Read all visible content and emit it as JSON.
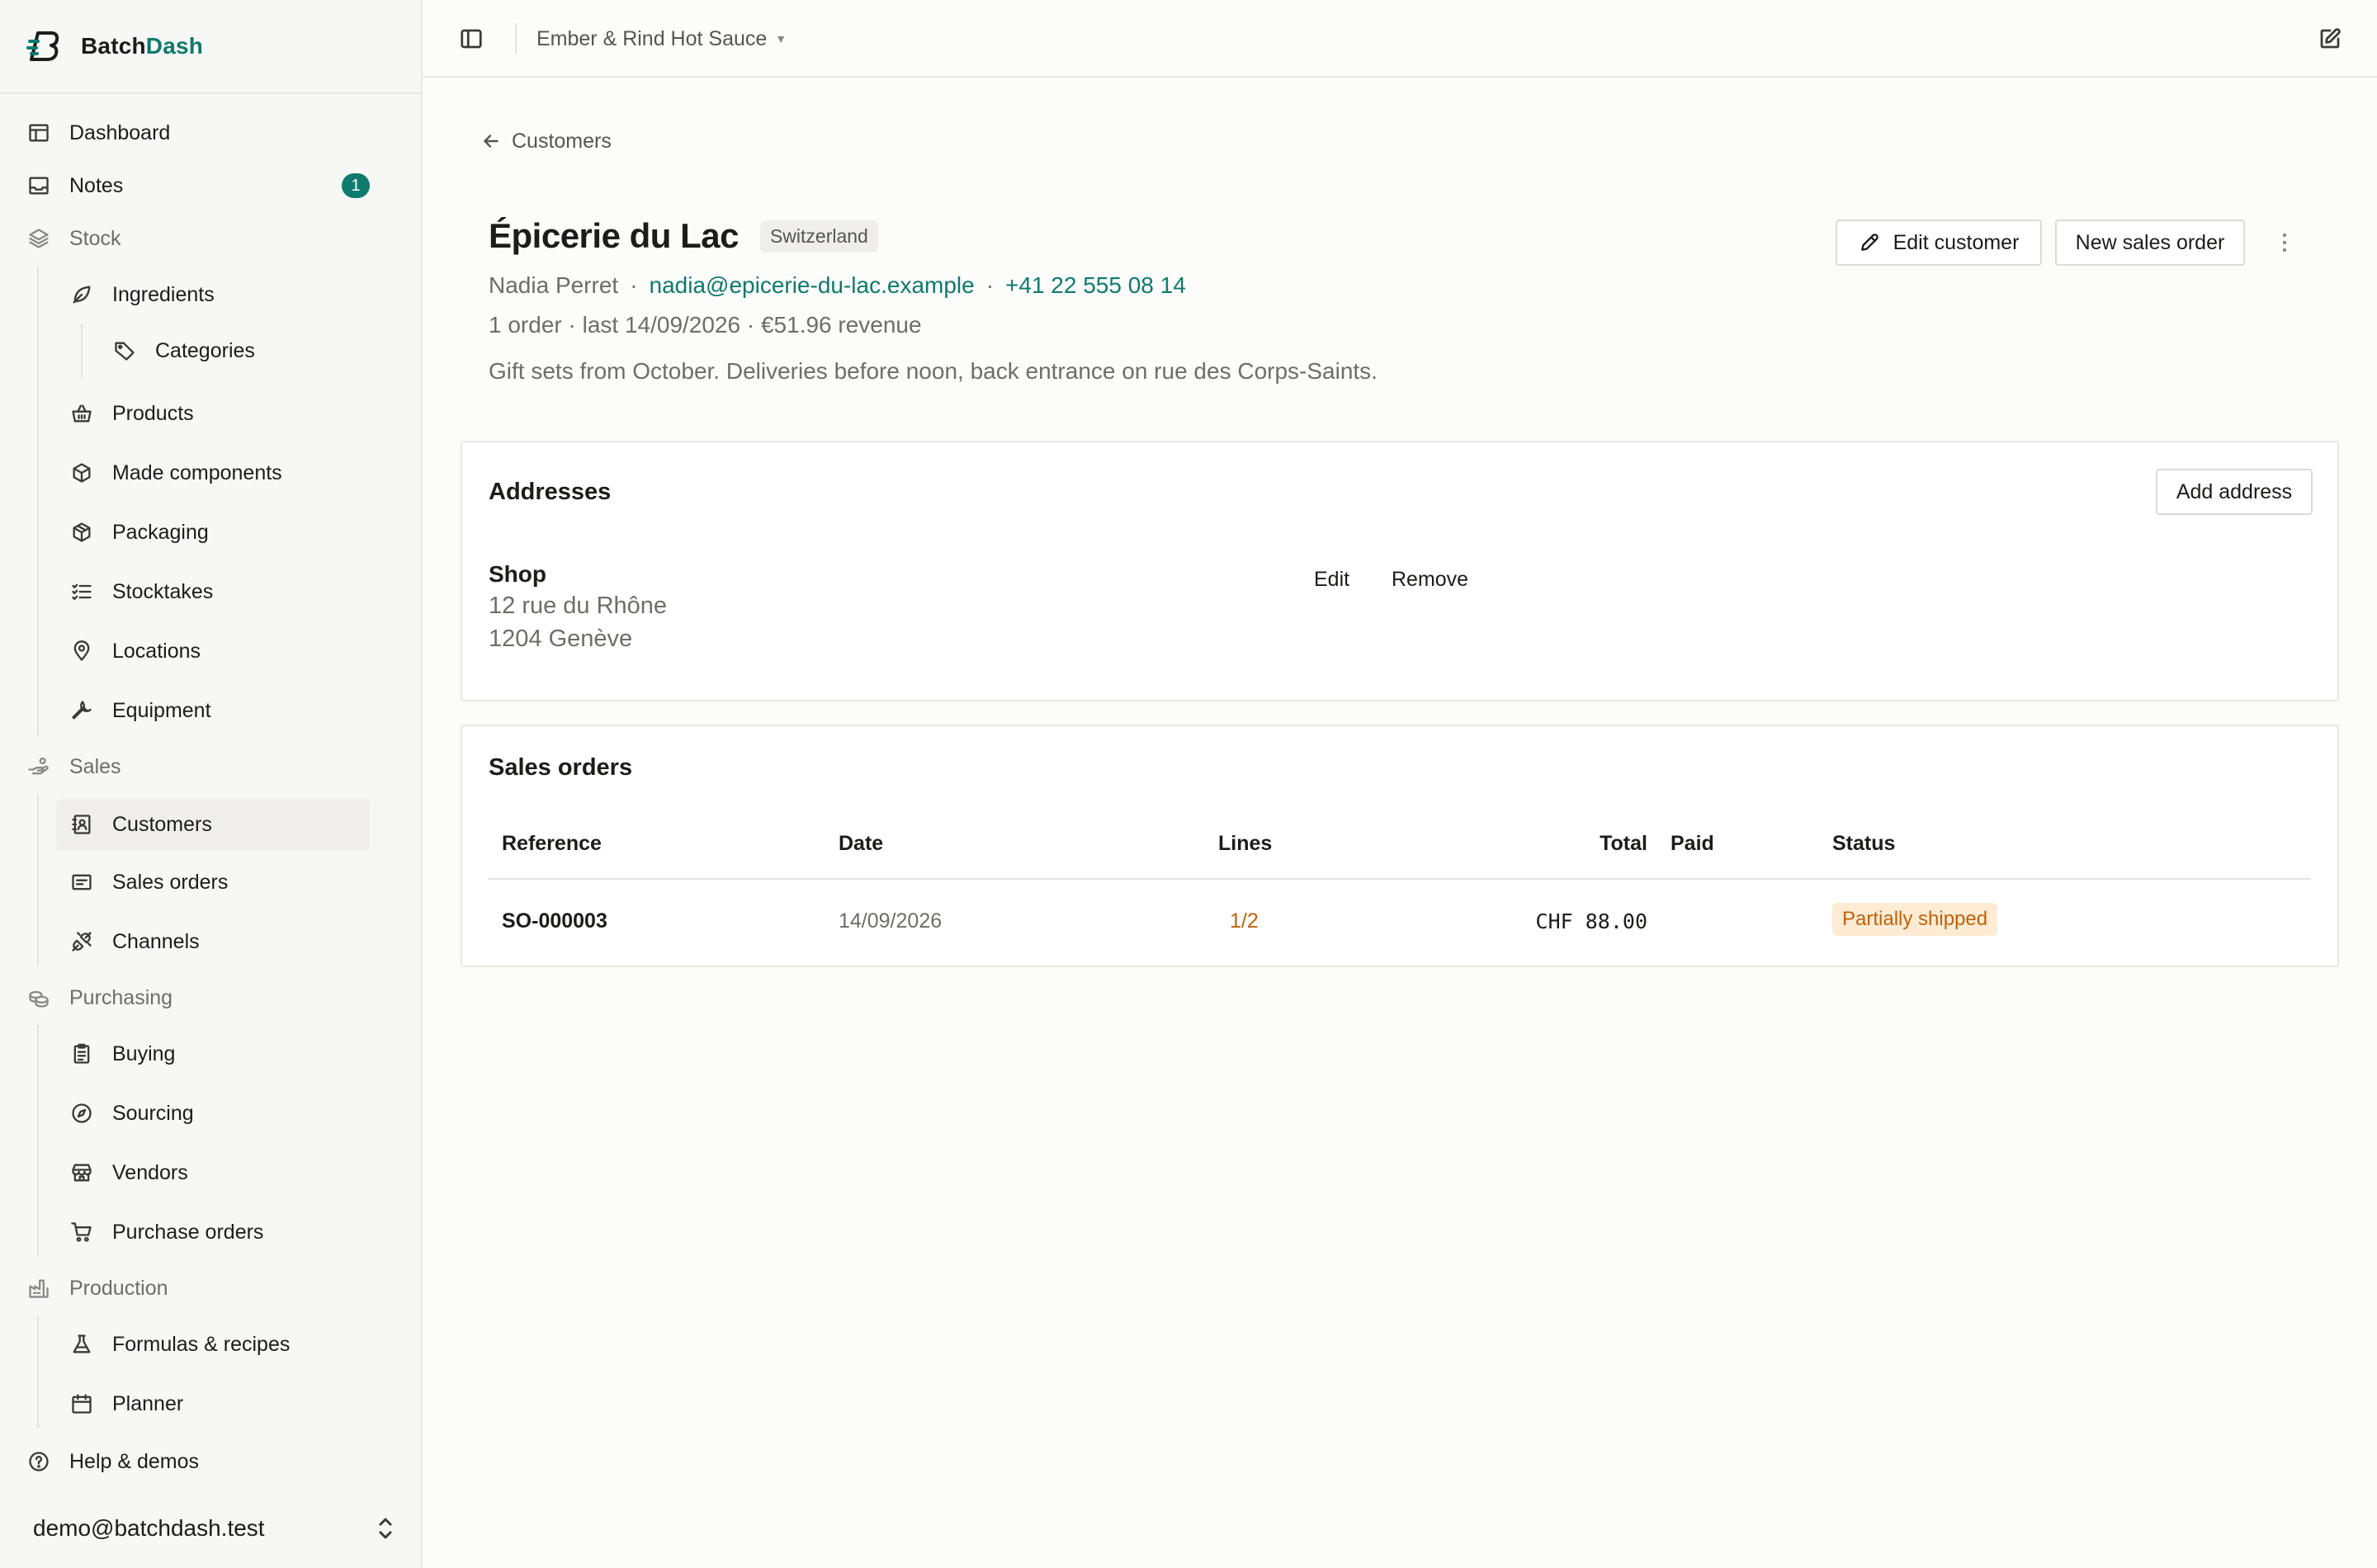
{
  "app": {
    "brand_first": "Batch",
    "brand_second": "Dash",
    "accent_color": "#0f7a6e"
  },
  "sidebar": {
    "dashboard": "Dashboard",
    "notes": "Notes",
    "notes_badge": "1",
    "stock": "Stock",
    "ingredients": "Ingredients",
    "categories": "Categories",
    "products": "Products",
    "made_components": "Made components",
    "packaging": "Packaging",
    "stocktakes": "Stocktakes",
    "locations": "Locations",
    "equipment": "Equipment",
    "sales": "Sales",
    "customers": "Customers",
    "sales_orders": "Sales orders",
    "channels": "Channels",
    "purchasing": "Purchasing",
    "buying": "Buying",
    "sourcing": "Sourcing",
    "vendors": "Vendors",
    "purchase_orders": "Purchase orders",
    "production": "Production",
    "formulas": "Formulas & recipes",
    "planner": "Planner",
    "help": "Help & demos",
    "account_email": "demo@batchdash.test"
  },
  "topbar": {
    "workspace": "Ember & Rind Hot Sauce"
  },
  "page": {
    "back_label": "Customers",
    "title": "Épicerie du Lac",
    "country": "Switzerland",
    "contact_name": "Nadia Perret",
    "separator": "·",
    "email": "nadia@epicerie-du-lac.example",
    "phone": "+41 22 555 08 14",
    "stats": "1 order · last 14/09/2026 · €51.96 revenue",
    "notes": "Gift sets from October. Deliveries before noon, back entrance on rue des Corps-Saints.",
    "edit_customer": "Edit customer",
    "new_sales_order": "New sales order"
  },
  "addresses": {
    "title": "Addresses",
    "add_button": "Add address",
    "items": [
      {
        "label": "Shop",
        "line1": "12 rue du Rhône",
        "line2": "1204 Genève",
        "edit": "Edit",
        "remove": "Remove"
      }
    ]
  },
  "sales_orders": {
    "title": "Sales orders",
    "columns": {
      "reference": "Reference",
      "date": "Date",
      "lines": "Lines",
      "total": "Total",
      "paid": "Paid",
      "status": "Status"
    },
    "rows": [
      {
        "reference": "SO-000003",
        "date": "14/09/2026",
        "lines": "1/2",
        "total": "CHF 88.00",
        "paid": "",
        "status": "Partially shipped"
      }
    ]
  }
}
